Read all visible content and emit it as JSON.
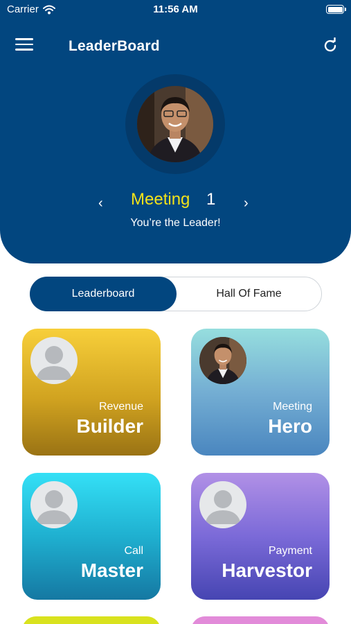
{
  "status_bar": {
    "carrier": "Carrier",
    "time": "11:56 AM"
  },
  "nav": {
    "title": "LeaderBoard"
  },
  "leader": {
    "metric": "Meeting",
    "count": "1",
    "message": "You’re the Leader!"
  },
  "segments": {
    "active": "Leaderboard",
    "inactive": "Hall Of Fame"
  },
  "cards": [
    {
      "subtitle": "Revenue",
      "title": "Builder",
      "avatar": "placeholder-avatar"
    },
    {
      "subtitle": "Meeting",
      "title": "Hero",
      "avatar": "user-photo"
    },
    {
      "subtitle": "Call",
      "title": "Master",
      "avatar": "placeholder-avatar"
    },
    {
      "subtitle": "Payment",
      "title": "Harvestor",
      "avatar": "placeholder-avatar"
    }
  ],
  "colors": {
    "header": "#02467f",
    "metric": "#f2e21a",
    "segment_active": "#02467f"
  },
  "icons": [
    "wifi-icon",
    "battery-icon",
    "hamburger-menu-icon",
    "refresh-icon",
    "chevron-left-icon",
    "chevron-right-icon"
  ]
}
